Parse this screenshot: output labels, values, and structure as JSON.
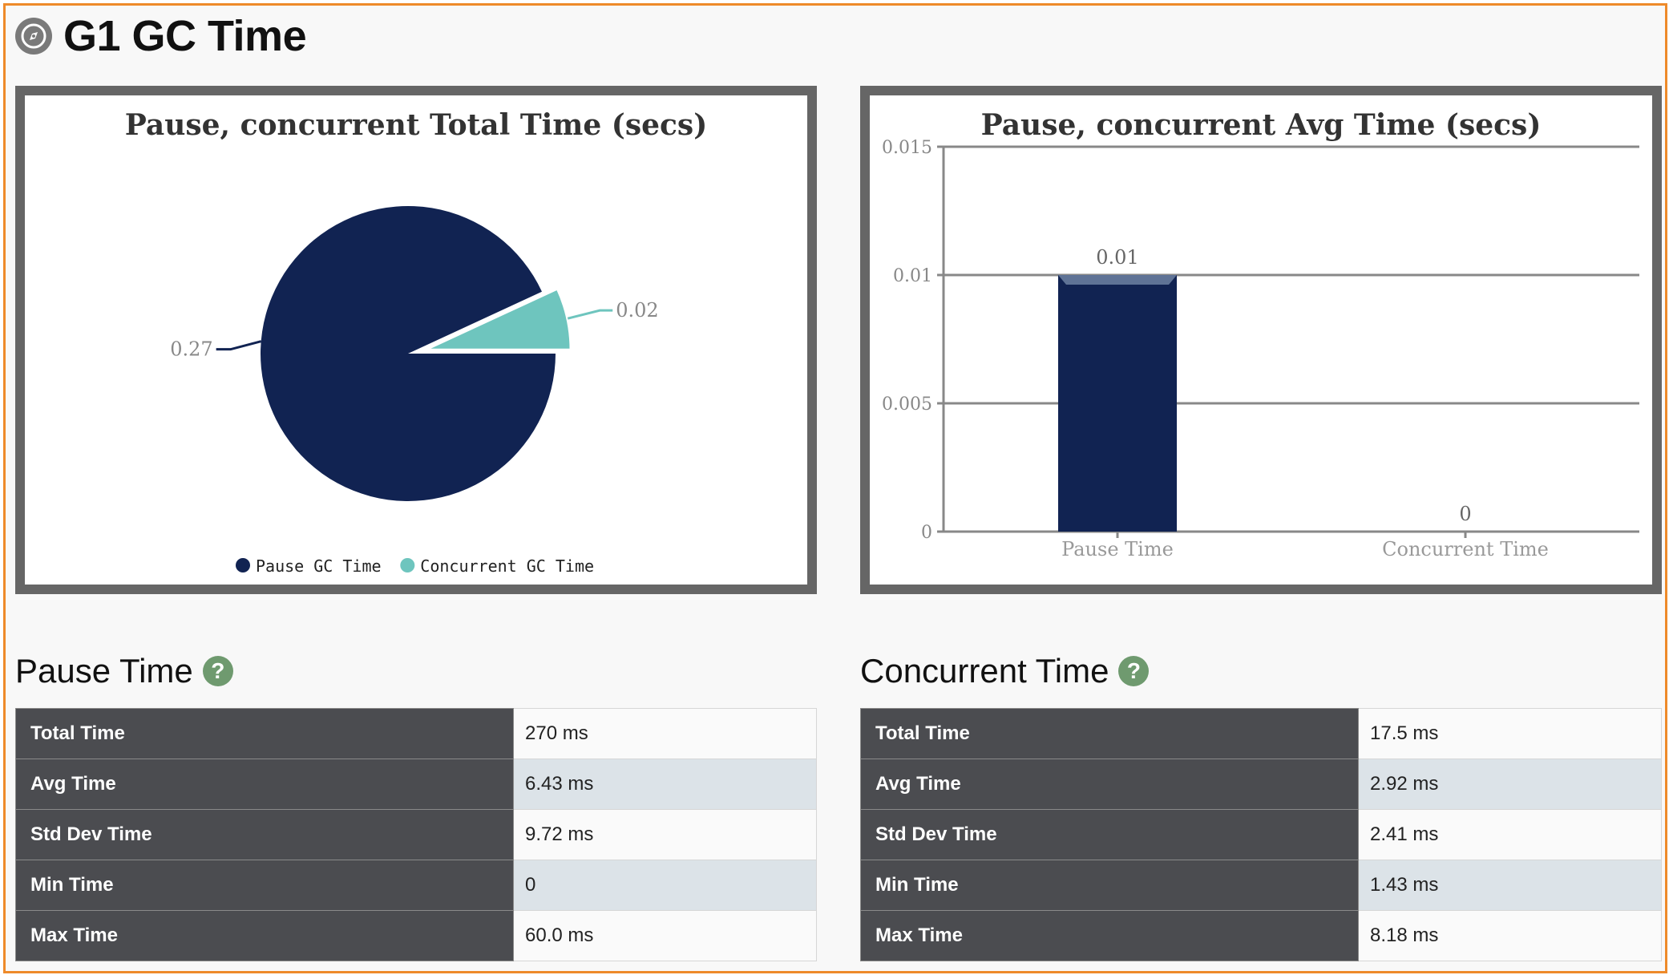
{
  "header": {
    "title": "G1 GC Time"
  },
  "colors": {
    "frame": "#ee8a2a",
    "pause": "#112352",
    "concurrent": "#6ec5be",
    "header_dark": "#4b4c50",
    "help_icon": "#6f9a6f"
  },
  "pie_chart": {
    "title": "Pause, concurrent Total Time (secs)",
    "slice_labels": [
      "0.27",
      "0.02"
    ],
    "legend": [
      "Pause GC Time",
      "Concurrent GC Time"
    ]
  },
  "bar_chart": {
    "title": "Pause, concurrent Avg Time (secs)",
    "y_ticks": [
      "0",
      "0.005",
      "0.01",
      "0.015"
    ],
    "data_labels": [
      "0.01",
      "0"
    ],
    "categories": [
      "Pause Time",
      "Concurrent Time"
    ]
  },
  "chart_data": [
    {
      "type": "pie",
      "title": "Pause, concurrent Total Time (secs)",
      "labels": [
        "Pause GC Time",
        "Concurrent GC Time"
      ],
      "values": [
        0.27,
        0.02
      ],
      "colors": [
        "#112352",
        "#6ec5be"
      ],
      "legend": "bottom"
    },
    {
      "type": "bar",
      "title": "Pause, concurrent Avg Time (secs)",
      "categories": [
        "Pause Time",
        "Concurrent Time"
      ],
      "values": [
        0.01,
        0
      ],
      "ylim": [
        0,
        0.015
      ],
      "yticks": [
        0,
        0.005,
        0.01,
        0.015
      ],
      "grid": true,
      "color": "#112352"
    }
  ],
  "pause_section": {
    "title": "Pause Time",
    "help": "?",
    "rows": [
      {
        "label": "Total Time",
        "value": "270 ms"
      },
      {
        "label": "Avg Time",
        "value": "6.43 ms"
      },
      {
        "label": "Std Dev Time",
        "value": "9.72 ms"
      },
      {
        "label": "Min Time",
        "value": "0"
      },
      {
        "label": "Max Time",
        "value": "60.0 ms"
      }
    ]
  },
  "concurrent_section": {
    "title": "Concurrent Time",
    "help": "?",
    "rows": [
      {
        "label": "Total Time",
        "value": "17.5 ms"
      },
      {
        "label": "Avg Time",
        "value": "2.92 ms"
      },
      {
        "label": "Std Dev Time",
        "value": "2.41 ms"
      },
      {
        "label": "Min Time",
        "value": "1.43 ms"
      },
      {
        "label": "Max Time",
        "value": "8.18 ms"
      }
    ]
  }
}
